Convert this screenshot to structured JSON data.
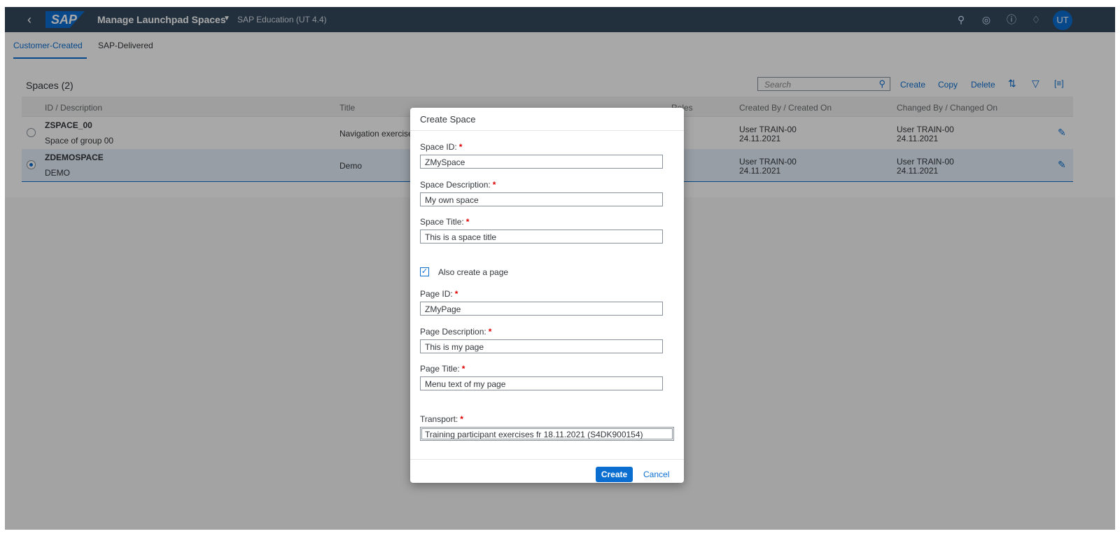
{
  "shell": {
    "back_icon": "chevron-left-icon",
    "logo": "SAP",
    "app_title": "Manage Launchpad Spaces",
    "system": "SAP Education (UT 4.4)",
    "avatar": "UT",
    "icons": [
      "search-icon",
      "copilot-icon",
      "help-icon",
      "bell-icon"
    ]
  },
  "tabs": [
    {
      "label": "Customer-Created",
      "active": true
    },
    {
      "label": "SAP-Delivered",
      "active": false
    }
  ],
  "table": {
    "title": "Spaces (2)",
    "search_placeholder": "Search",
    "toolbar": {
      "create": "Create",
      "copy": "Copy",
      "delete": "Delete"
    },
    "columns": [
      "ID / Description",
      "Title",
      "Roles",
      "Created By / Created On",
      "Changed By / Changed On"
    ],
    "rows": [
      {
        "id": "ZSPACE_00",
        "desc": "Space of group 00",
        "title": "Navigation exercise",
        "created_by": "User TRAIN-00",
        "created_on": "24.11.2021",
        "changed_by": "User TRAIN-00",
        "changed_on": "24.11.2021",
        "selected": false
      },
      {
        "id": "ZDEMOSPACE",
        "desc": "DEMO",
        "title": "Demo",
        "created_by": "User TRAIN-00",
        "created_on": "24.11.2021",
        "changed_by": "User TRAIN-00",
        "changed_on": "24.11.2021",
        "selected": true
      }
    ]
  },
  "dialog": {
    "title": "Create Space",
    "space_id": {
      "label": "Space ID:",
      "value": "ZMySpace"
    },
    "space_desc": {
      "label": "Space Description:",
      "value": "My own space"
    },
    "space_title": {
      "label": "Space Title:",
      "value": "This is a space title"
    },
    "also_page": {
      "label": "Also create a page",
      "checked": true
    },
    "page_id": {
      "label": "Page ID:",
      "value": "ZMyPage"
    },
    "page_desc": {
      "label": "Page Description:",
      "value": "This is my page"
    },
    "page_title": {
      "label": "Page Title:",
      "value": "Menu text of my page"
    },
    "transport": {
      "label": "Transport:",
      "value": "Training participant exercises  fr 18.11.2021 (S4DK900154)"
    },
    "required_mark": "*",
    "create": "Create",
    "cancel": "Cancel"
  },
  "colors": {
    "shell": "#354a5f",
    "accent": "#0a6ed1",
    "required": "#dd0000"
  }
}
